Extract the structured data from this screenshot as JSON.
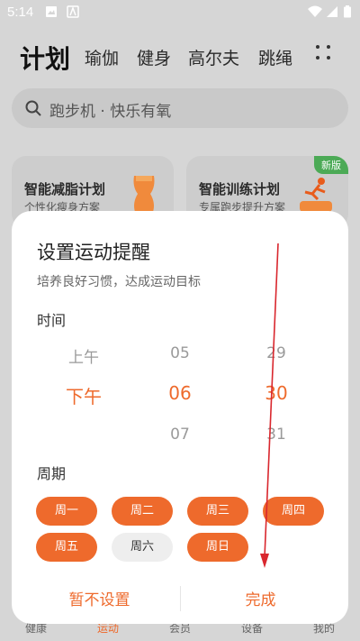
{
  "status_bar": {
    "time": "5:14"
  },
  "header": {
    "tabs": [
      {
        "label": "计划"
      },
      {
        "label": "瑜伽"
      },
      {
        "label": "健身"
      },
      {
        "label": "高尔夫"
      },
      {
        "label": "跳绳"
      }
    ]
  },
  "search": {
    "placeholder": "跑步机 · 快乐有氧"
  },
  "cards": [
    {
      "title": "智能减脂计划",
      "subtitle": "个性化瘦身方案"
    },
    {
      "title": "智能训练计划",
      "subtitle": "专属跑步提升方案",
      "badge": "新版"
    }
  ],
  "bottom_nav": [
    {
      "label": "健康"
    },
    {
      "label": "运动"
    },
    {
      "label": "会员"
    },
    {
      "label": "设备"
    },
    {
      "label": "我的"
    }
  ],
  "dialog": {
    "title": "设置运动提醒",
    "subtitle": "培养良好习惯，达成运动目标",
    "time_label": "时间",
    "picker": {
      "period": {
        "prev": "上午",
        "selected": "下午"
      },
      "hour": {
        "prev": "05",
        "selected": "06",
        "next": "07"
      },
      "minute": {
        "prev": "29",
        "selected": "30",
        "next": "31"
      }
    },
    "cycle_label": "周期",
    "days": [
      {
        "label": "周一",
        "selected": true
      },
      {
        "label": "周二",
        "selected": true
      },
      {
        "label": "周三",
        "selected": true
      },
      {
        "label": "周四",
        "selected": true
      },
      {
        "label": "周五",
        "selected": true
      },
      {
        "label": "周六",
        "selected": false
      },
      {
        "label": "周日",
        "selected": true
      }
    ],
    "cancel_label": "暂不设置",
    "confirm_label": "完成"
  },
  "colors": {
    "accent": "#ee6a2c",
    "annotation": "#d9272e",
    "badge": "#4caa56"
  }
}
